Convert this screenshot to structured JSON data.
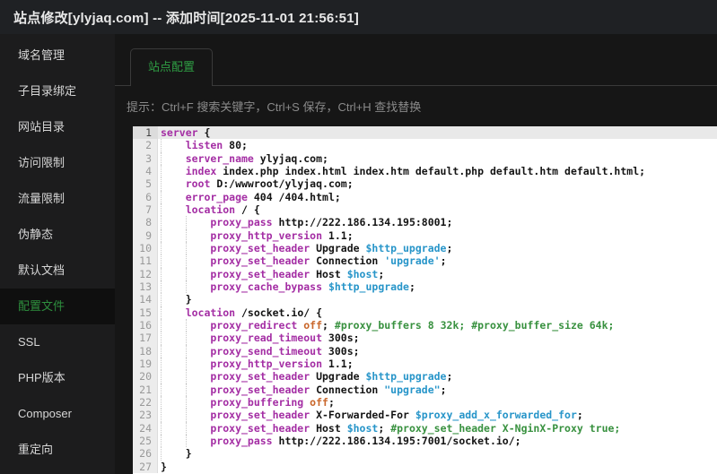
{
  "window": {
    "title": "站点修改[ylyjaq.com] -- 添加时间[2025-11-01 21:56:51]"
  },
  "sidebar": {
    "items": [
      {
        "key": "domain-manage",
        "label": "域名管理",
        "active": false
      },
      {
        "key": "subdir-bind",
        "label": "子目录绑定",
        "active": false
      },
      {
        "key": "site-directory",
        "label": "网站目录",
        "active": false
      },
      {
        "key": "access-limit",
        "label": "访问限制",
        "active": false
      },
      {
        "key": "traffic-limit",
        "label": "流量限制",
        "active": false
      },
      {
        "key": "rewrite",
        "label": "伪静态",
        "active": false
      },
      {
        "key": "default-doc",
        "label": "默认文档",
        "active": false
      },
      {
        "key": "config-file",
        "label": "配置文件",
        "active": true
      },
      {
        "key": "ssl",
        "label": "SSL",
        "active": false
      },
      {
        "key": "php-version",
        "label": "PHP版本",
        "active": false
      },
      {
        "key": "composer",
        "label": "Composer",
        "active": false
      },
      {
        "key": "redirect",
        "label": "重定向",
        "active": false
      }
    ]
  },
  "tabs": [
    {
      "key": "site-config",
      "label": "站点配置",
      "active": true
    }
  ],
  "hint": "提示：Ctrl+F 搜索关键字，Ctrl+S 保存，Ctrl+H 查找替换",
  "colors": {
    "accent_green": "#2f9e44",
    "keyword": "#a42ea4",
    "variable": "#2795c9",
    "string": "#2795c9",
    "atom": "#c9662a",
    "comment": "#38913f",
    "editor_bg": "#ffffff",
    "panel_bg": "#161616"
  },
  "editor": {
    "language": "nginx",
    "active_line": 1,
    "lines": [
      {
        "indent": 0,
        "tokens": [
          [
            "kw",
            "server"
          ],
          [
            "pl",
            " {"
          ]
        ]
      },
      {
        "indent": 1,
        "tokens": [
          [
            "kw",
            "listen"
          ],
          [
            "pl",
            " 80;"
          ]
        ]
      },
      {
        "indent": 1,
        "tokens": [
          [
            "kw",
            "server_name"
          ],
          [
            "pl",
            " ylyjaq.com;"
          ]
        ]
      },
      {
        "indent": 1,
        "tokens": [
          [
            "kw",
            "index"
          ],
          [
            "pl",
            " index.php index.html index.htm default.php default.htm default.html;"
          ]
        ]
      },
      {
        "indent": 1,
        "tokens": [
          [
            "kw",
            "root"
          ],
          [
            "pl",
            " D:/wwwroot/ylyjaq.com;"
          ]
        ]
      },
      {
        "indent": 1,
        "tokens": [
          [
            "kw",
            "error_page"
          ],
          [
            "pl",
            " 404 /404.html;"
          ]
        ]
      },
      {
        "indent": 1,
        "tokens": [
          [
            "kw",
            "location"
          ],
          [
            "pl",
            " / {"
          ]
        ]
      },
      {
        "indent": 2,
        "tokens": [
          [
            "kw",
            "proxy_pass"
          ],
          [
            "pl",
            " http://222.186.134.195:8001;"
          ]
        ]
      },
      {
        "indent": 2,
        "tokens": [
          [
            "kw",
            "proxy_http_version"
          ],
          [
            "pl",
            " 1.1;"
          ]
        ]
      },
      {
        "indent": 2,
        "tokens": [
          [
            "kw",
            "proxy_set_header"
          ],
          [
            "pl",
            " Upgrade "
          ],
          [
            "var",
            "$http_upgrade"
          ],
          [
            "pl",
            ";"
          ]
        ]
      },
      {
        "indent": 2,
        "tokens": [
          [
            "kw",
            "proxy_set_header"
          ],
          [
            "pl",
            " Connection "
          ],
          [
            "str",
            "'upgrade'"
          ],
          [
            "pl",
            ";"
          ]
        ]
      },
      {
        "indent": 2,
        "tokens": [
          [
            "kw",
            "proxy_set_header"
          ],
          [
            "pl",
            " Host "
          ],
          [
            "var",
            "$host"
          ],
          [
            "pl",
            ";"
          ]
        ]
      },
      {
        "indent": 2,
        "tokens": [
          [
            "kw",
            "proxy_cache_bypass"
          ],
          [
            "pl",
            " "
          ],
          [
            "var",
            "$http_upgrade"
          ],
          [
            "pl",
            ";"
          ]
        ]
      },
      {
        "indent": 1,
        "tokens": [
          [
            "pl",
            "}"
          ]
        ]
      },
      {
        "indent": 1,
        "tokens": [
          [
            "kw",
            "location"
          ],
          [
            "pl",
            " /socket.io/ {"
          ]
        ]
      },
      {
        "indent": 2,
        "tokens": [
          [
            "kw",
            "proxy_redirect"
          ],
          [
            "pl",
            " "
          ],
          [
            "atom",
            "off"
          ],
          [
            "pl",
            "; "
          ],
          [
            "com",
            "#proxy_buffers 8 32k; #proxy_buffer_size 64k;"
          ]
        ]
      },
      {
        "indent": 2,
        "tokens": [
          [
            "kw",
            "proxy_read_timeout"
          ],
          [
            "pl",
            " 300s;"
          ]
        ]
      },
      {
        "indent": 2,
        "tokens": [
          [
            "kw",
            "proxy_send_timeout"
          ],
          [
            "pl",
            " 300s;"
          ]
        ]
      },
      {
        "indent": 2,
        "tokens": [
          [
            "kw",
            "proxy_http_version"
          ],
          [
            "pl",
            " 1.1;"
          ]
        ]
      },
      {
        "indent": 2,
        "tokens": [
          [
            "kw",
            "proxy_set_header"
          ],
          [
            "pl",
            " Upgrade "
          ],
          [
            "var",
            "$http_upgrade"
          ],
          [
            "pl",
            ";"
          ]
        ]
      },
      {
        "indent": 2,
        "tokens": [
          [
            "kw",
            "proxy_set_header"
          ],
          [
            "pl",
            " Connection "
          ],
          [
            "str",
            "\"upgrade\""
          ],
          [
            "pl",
            ";"
          ]
        ]
      },
      {
        "indent": 2,
        "tokens": [
          [
            "kw",
            "proxy_buffering"
          ],
          [
            "pl",
            " "
          ],
          [
            "atom",
            "off"
          ],
          [
            "pl",
            ";"
          ]
        ]
      },
      {
        "indent": 2,
        "tokens": [
          [
            "kw",
            "proxy_set_header"
          ],
          [
            "pl",
            " X-Forwarded-For "
          ],
          [
            "var",
            "$proxy_add_x_forwarded_for"
          ],
          [
            "pl",
            ";"
          ]
        ]
      },
      {
        "indent": 2,
        "tokens": [
          [
            "kw",
            "proxy_set_header"
          ],
          [
            "pl",
            " Host "
          ],
          [
            "var",
            "$host"
          ],
          [
            "pl",
            "; "
          ],
          [
            "com",
            "#proxy_set_header X-NginX-Proxy true;"
          ]
        ]
      },
      {
        "indent": 2,
        "tokens": [
          [
            "kw",
            "proxy_pass"
          ],
          [
            "pl",
            " http://222.186.134.195:7001/socket.io/;"
          ]
        ]
      },
      {
        "indent": 1,
        "tokens": [
          [
            "pl",
            "}"
          ]
        ]
      },
      {
        "indent": 0,
        "tokens": [
          [
            "pl",
            "}"
          ]
        ]
      }
    ]
  }
}
